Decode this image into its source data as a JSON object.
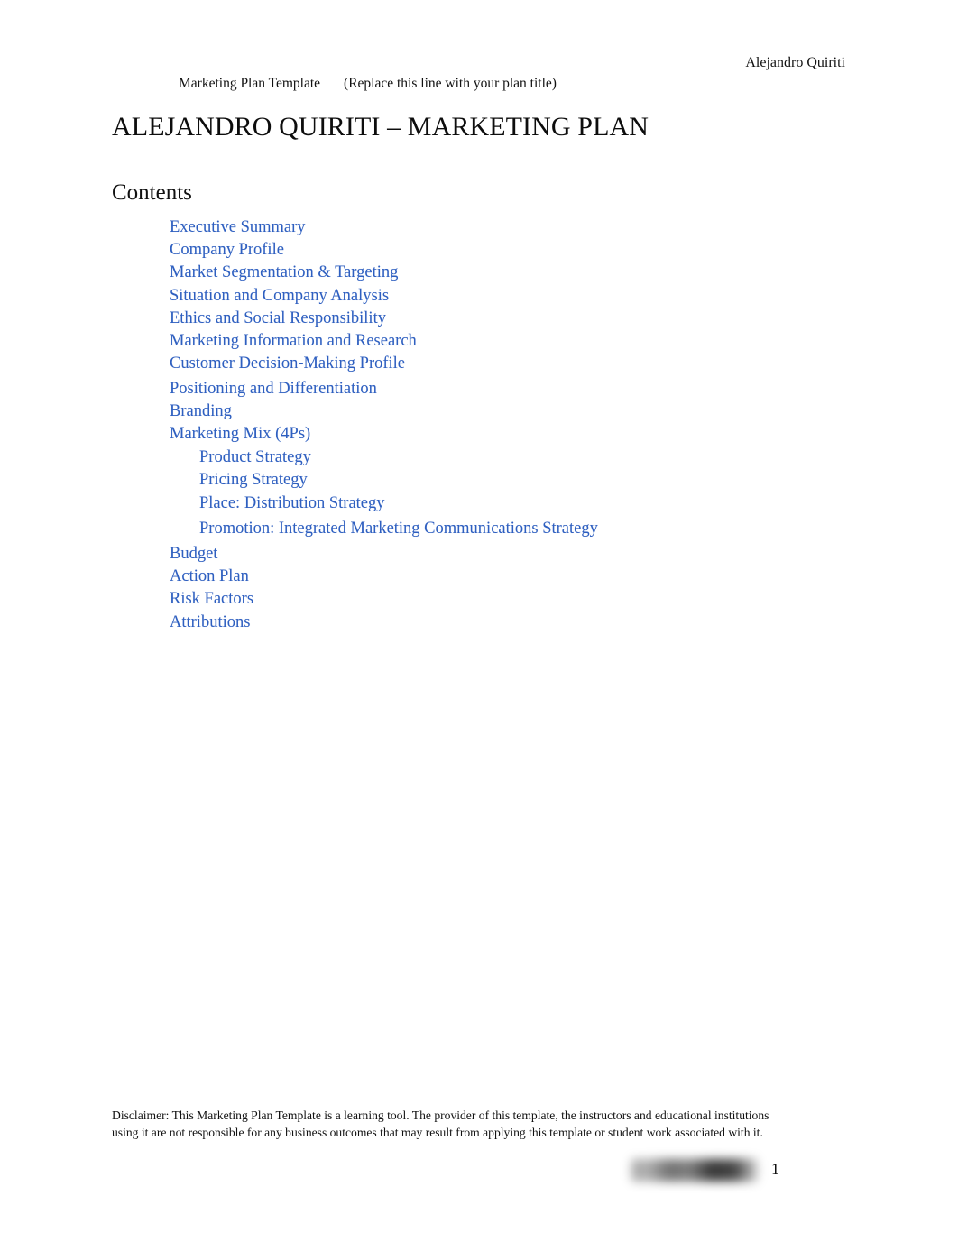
{
  "header": {
    "author": "Alejandro Quiriti",
    "template_name": "Marketing Plan Template",
    "template_hint": "(Replace this line with your plan title)"
  },
  "document": {
    "title": "ALEJANDRO QUIRITI – MARKETING PLAN",
    "contents_heading": "Contents"
  },
  "toc": {
    "items": [
      {
        "label": "Executive Summary",
        "level": 1
      },
      {
        "label": "Company Profile",
        "level": 1
      },
      {
        "label": "Market Segmentation & Targeting",
        "level": 1
      },
      {
        "label": "Situation and Company Analysis",
        "level": 1
      },
      {
        "label": "Ethics and Social Responsibility",
        "level": 1
      },
      {
        "label": "Marketing Information and Research",
        "level": 1
      },
      {
        "label": "Customer Decision-Making Profile",
        "level": 1
      },
      {
        "label": "Positioning and Differentiation",
        "level": 1
      },
      {
        "label": "Branding",
        "level": 1
      },
      {
        "label": "Marketing Mix (4Ps)",
        "level": 1
      },
      {
        "label": "Product Strategy",
        "level": 2
      },
      {
        "label": "Pricing Strategy",
        "level": 2
      },
      {
        "label": "Place: Distribution Strategy",
        "level": 2
      },
      {
        "label": "Promotion: Integrated Marketing Communications Strategy",
        "level": 2
      },
      {
        "label": "Budget",
        "level": 1
      },
      {
        "label": "Action Plan",
        "level": 1
      },
      {
        "label": "Risk Factors",
        "level": 1
      },
      {
        "label": "Attributions",
        "level": 1
      }
    ],
    "link_color": "#2e5fc0"
  },
  "footer": {
    "disclaimer": "Disclaimer: This Marketing Plan Template is a learning tool. The provider of this template, the instructors and educational institutions using it are not responsible for any business outcomes that may result from applying this template or student work associated with it.",
    "page_number": "1",
    "redacted_label": "redacted-text"
  }
}
